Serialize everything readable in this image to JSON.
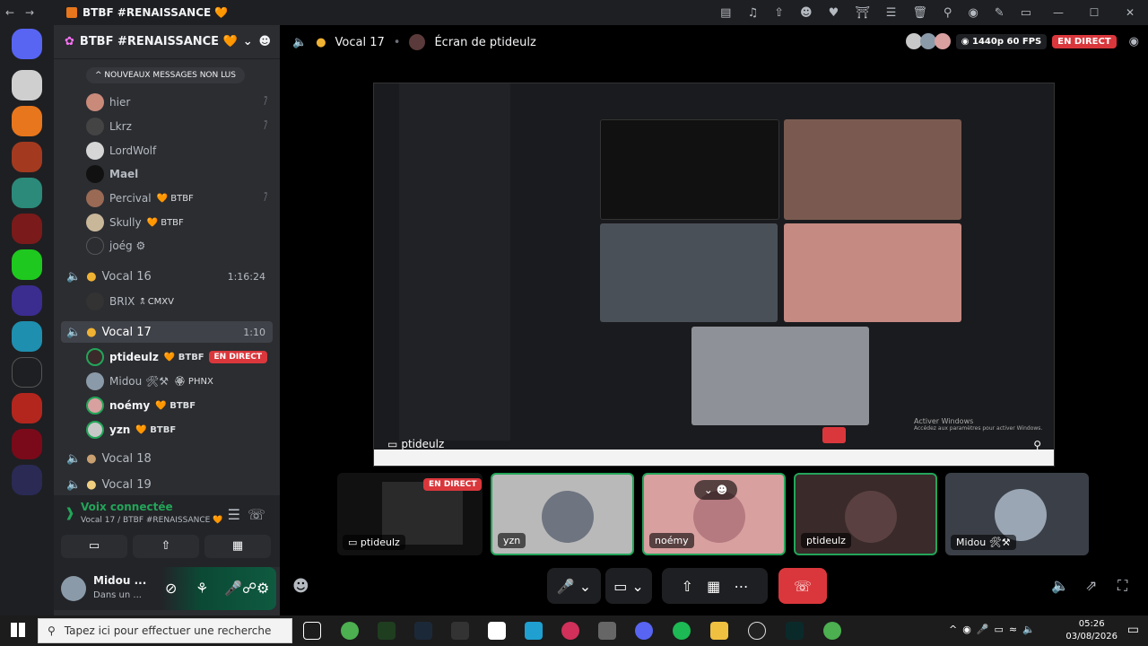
{
  "titlebar": {
    "app_title": "BTBF #RENAISSANCE 🧡",
    "back": "←",
    "forward": "→",
    "window_controls": [
      "—",
      "☐",
      "✕"
    ]
  },
  "server": {
    "name": "BTBF #RENAISSANCE 🧡"
  },
  "channels": {
    "new_messages_pill": "NOUVEAUX MESSAGES NON LUS",
    "users_top": [
      {
        "name": "hier",
        "color": "#b5bac1"
      },
      {
        "name": "Lkrz",
        "color": "#b5bac1"
      },
      {
        "name": "LordWolf",
        "color": "#b5bac1"
      },
      {
        "name": "Mael",
        "color": "#b5bac1"
      },
      {
        "name": "Percival",
        "tag": "🧡 BTBF"
      },
      {
        "name": "Skully",
        "tag": "🧡 BTBF"
      },
      {
        "name": "joég ⚙"
      }
    ],
    "vocal16": {
      "name": "Vocal 16",
      "time": "1:16:24"
    },
    "vocal16_users": [
      {
        "name": "BRIX",
        "tag": "🕱 CMXV"
      }
    ],
    "vocal17": {
      "name": "Vocal 17",
      "time": "1:10"
    },
    "vocal17_users": [
      {
        "name": "ptideulz",
        "tag": "🧡 BTBF",
        "live": "EN DIRECT"
      },
      {
        "name": "Midou 🛠⚒",
        "tag": "🏵 PHNX"
      },
      {
        "name": "noémy",
        "tag": "🧡 BTBF"
      },
      {
        "name": "yzn",
        "tag": "🧡 BTBF"
      }
    ],
    "vocal18": {
      "name": "Vocal 18"
    },
    "vocal19": {
      "name": "Vocal 19"
    }
  },
  "voice_connected": {
    "title": "Voix connectée",
    "subtitle": "Vocal 17 / BTBF #RENAISSANCE 🧡"
  },
  "user_panel": {
    "name": "Midou ...",
    "status": "Dans un ..."
  },
  "main_header": {
    "channel": "Vocal 17",
    "screen_label": "Écran de ptideulz",
    "quality": "1440p 60 FPS",
    "live": "EN DIRECT"
  },
  "screenshare": {
    "streamer_label": "ptideulz",
    "watermark_title": "Activer Windows",
    "watermark_sub": "Accédez aux paramètres pour activer Windows."
  },
  "thumbnails": [
    {
      "name": "ptideulz",
      "live": "EN DIRECT"
    },
    {
      "name": "yzn"
    },
    {
      "name": "noémy"
    },
    {
      "name": "ptideulz"
    },
    {
      "name": "Midou 🛠⚒"
    }
  ],
  "taskbar": {
    "search_placeholder": "Tapez ici pour effectuer une recherche",
    "time": "05:26",
    "date": "03/08/2026"
  },
  "colors": {
    "accent_live": "#da373c",
    "discord_blurple": "#5865f2",
    "green_connected": "#23a559",
    "channel_bg": "#2b2d31",
    "rail_bg": "#1e1f22"
  }
}
